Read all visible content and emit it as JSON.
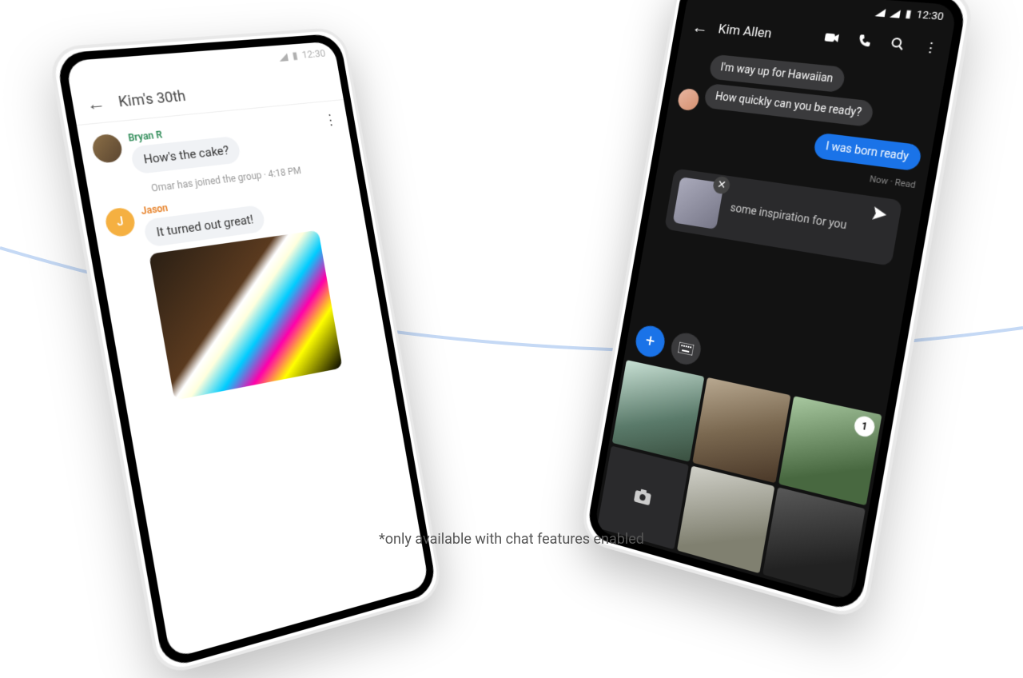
{
  "caption": "*only available with chat features enabled",
  "left_phone": {
    "status_time": "12:30",
    "title": "Kim's 30th",
    "messages": [
      {
        "sender": "Bryan R",
        "text": "How's the cake?"
      }
    ],
    "system_msg": "Omar has joined the group · 4:18 PM",
    "message2": {
      "sender": "Jason",
      "text": "It turned out great!"
    }
  },
  "right_phone": {
    "status_time": "12:30",
    "contact": "Kim Allen",
    "incoming": [
      "I'm way up for Hawaiian",
      "How quickly can you be ready?"
    ],
    "outgoing": "I was born ready",
    "outgoing_meta": "Now · Read",
    "compose_text": "some inspiration for you",
    "gallery_count": "1"
  }
}
